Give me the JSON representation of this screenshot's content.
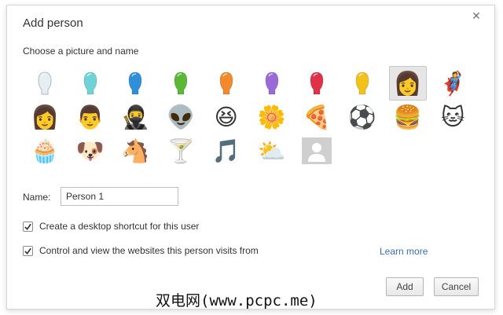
{
  "dialog": {
    "title": "Add person",
    "subtitle": "Choose a picture and name"
  },
  "avatars": [
    {
      "name": "avatar-generic-white",
      "color": "#e6eef2"
    },
    {
      "name": "avatar-generic-cyan",
      "color": "#6fd3d6"
    },
    {
      "name": "avatar-generic-blue",
      "color": "#2f8fd8"
    },
    {
      "name": "avatar-generic-green",
      "color": "#5ab836"
    },
    {
      "name": "avatar-generic-orange",
      "color": "#f08a2c"
    },
    {
      "name": "avatar-generic-purple",
      "color": "#9a6ad6"
    },
    {
      "name": "avatar-generic-red",
      "color": "#e0304a"
    },
    {
      "name": "avatar-generic-yellow",
      "color": "#f2c21a"
    },
    {
      "name": "avatar-businesswoman",
      "glyph": "👩"
    },
    {
      "name": "avatar-superhero",
      "glyph": "🦸"
    },
    {
      "name": "avatar-woman-sunglasses",
      "glyph": "👩"
    },
    {
      "name": "avatar-man",
      "glyph": "👨"
    },
    {
      "name": "avatar-ninja",
      "glyph": "🥷"
    },
    {
      "name": "avatar-alien",
      "glyph": "👽"
    },
    {
      "name": "avatar-awesome-smiley",
      "glyph": "😆"
    },
    {
      "name": "avatar-flower",
      "glyph": "🌼"
    },
    {
      "name": "avatar-pizza",
      "glyph": "🍕"
    },
    {
      "name": "avatar-soccer-ball",
      "glyph": "⚽"
    },
    {
      "name": "avatar-burger",
      "glyph": "🍔"
    },
    {
      "name": "avatar-cat",
      "glyph": "🐱"
    },
    {
      "name": "avatar-cupcake",
      "glyph": "🧁"
    },
    {
      "name": "avatar-dog",
      "glyph": "🐶"
    },
    {
      "name": "avatar-horse",
      "glyph": "🐴"
    },
    {
      "name": "avatar-margarita",
      "glyph": "🍸"
    },
    {
      "name": "avatar-music-note",
      "glyph": "🎵"
    },
    {
      "name": "avatar-sun-cloud",
      "glyph": "⛅"
    },
    {
      "name": "avatar-placeholder-silhouette",
      "glyph": ""
    }
  ],
  "selected_avatar": "avatar-businesswoman",
  "name_field": {
    "label": "Name:",
    "value": "Person 1"
  },
  "options": {
    "desktop_shortcut": {
      "label": "Create a desktop shortcut for this user",
      "checked": true
    },
    "supervised": {
      "label": "Control and view the websites this person visits from",
      "checked": true
    },
    "learn_more": "Learn more"
  },
  "buttons": {
    "add": "Add",
    "cancel": "Cancel"
  },
  "watermark": "双电网(www.pcpc.me)",
  "colors": {
    "link": "#3a6fb8",
    "selected_bg": "#e6e6e6"
  }
}
